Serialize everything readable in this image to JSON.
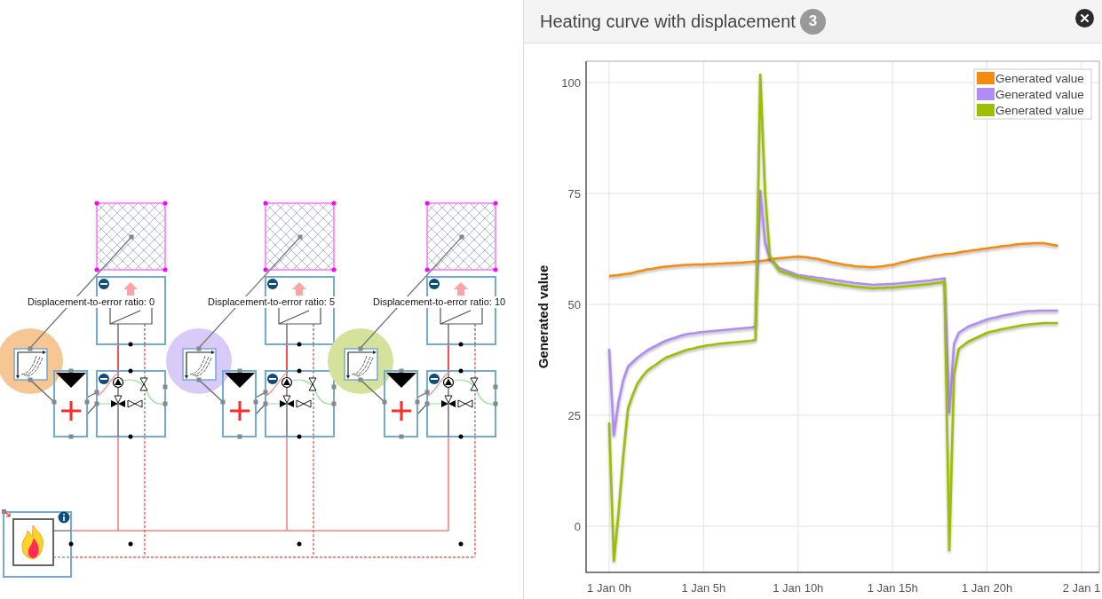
{
  "diagram": {
    "units": [
      {
        "label": "Displacement-to-error ratio: 0",
        "color": "#f6c793"
      },
      {
        "label": "Displacement-to-error ratio: 5",
        "color": "#d8cbf8"
      },
      {
        "label": "Displacement-to-error ratio: 10",
        "color": "#d5e29b"
      }
    ]
  },
  "panel": {
    "title": "Heating curve with displacement",
    "badge": "3",
    "chart_data": {
      "type": "line",
      "ylabel": "Generated value",
      "grid": true,
      "categories": [
        "1 Jan 0h",
        null,
        null,
        null,
        null,
        null,
        null,
        null,
        null,
        null,
        null,
        null,
        null,
        null,
        null,
        null,
        null,
        null,
        null,
        null,
        "1 Jan 5h",
        null,
        null,
        null,
        null,
        null,
        null,
        null,
        null,
        null,
        null,
        null,
        null,
        null,
        null,
        null,
        null,
        null,
        null,
        null,
        "1 Jan 10h",
        null,
        null,
        null,
        null,
        null,
        null,
        null,
        null,
        null,
        null,
        null,
        null,
        null,
        null,
        null,
        null,
        null,
        null,
        null,
        "1 Jan 15h",
        null,
        null,
        null,
        null,
        null,
        null,
        null,
        null,
        null,
        null,
        null,
        null,
        null,
        null,
        null,
        null,
        null,
        null,
        null,
        "1 Jan 20h",
        null,
        null,
        null,
        null,
        null,
        null,
        null,
        null,
        null,
        null,
        null,
        null,
        null,
        null,
        null,
        null,
        null,
        null,
        null,
        "2 Jan 1"
      ],
      "series": [
        {
          "name": "Generated value",
          "color": "#f7890c",
          "values": [
            56.4,
            56.5,
            56.6,
            56.8,
            56.9,
            57.1,
            57.4,
            57.6,
            57.9,
            58.0,
            58.2,
            58.4,
            58.5,
            58.6,
            58.7,
            58.8,
            58.9,
            58.9,
            59.0,
            59.0,
            59.0,
            59.1,
            59.1,
            59.2,
            59.2,
            59.3,
            59.3,
            59.4,
            59.4,
            59.5,
            59.6,
            59.7,
            59.8,
            59.9,
            60.1,
            60.3,
            60.4,
            60.5,
            60.6,
            60.7,
            60.8,
            60.7,
            60.6,
            60.4,
            60.3,
            60.0,
            59.8,
            59.5,
            59.3,
            59.1,
            58.9,
            58.8,
            58.6,
            58.5,
            58.5,
            58.4,
            58.4,
            58.5,
            58.6,
            58.8,
            58.9,
            59.2,
            59.5,
            59.7,
            60.0,
            60.2,
            60.4,
            60.6,
            60.8,
            61.0,
            61.1,
            61.3,
            61.4,
            61.5,
            61.7,
            61.9,
            62.0,
            62.2,
            62.3,
            62.5,
            62.6,
            62.8,
            62.9,
            63.1,
            63.2,
            63.3,
            63.5,
            63.6,
            63.7,
            63.7,
            63.8,
            63.8,
            63.8,
            63.6,
            63.4,
            63.2,
            null,
            null,
            null,
            null,
            null
          ]
        },
        {
          "name": "Generated value",
          "color": "#b18cf7",
          "values": [
            40,
            20.5,
            28,
            33,
            36,
            37,
            38,
            38.8,
            39.6,
            40.2,
            40.7,
            41.3,
            41.8,
            42.2,
            42.5,
            42.9,
            43.2,
            43.4,
            43.5,
            43.7,
            43.8,
            43.9,
            44.0,
            44.1,
            44.2,
            44.3,
            44.4,
            44.5,
            44.6,
            44.7,
            44.8,
            45,
            75.6,
            63.9,
            60.6,
            59.4,
            58.2,
            57.8,
            57.4,
            57.0,
            56.6,
            56.5,
            56.3,
            56.2,
            56,
            55.9,
            55.7,
            55.6,
            55.4,
            55.3,
            55.1,
            55.0,
            54.8,
            54.7,
            54.6,
            54.5,
            54.4,
            54.5,
            54.5,
            54.6,
            54.6,
            54.7,
            54.8,
            54.9,
            55,
            55.1,
            55.2,
            55.3,
            55.4,
            55.6,
            55.7,
            55.9,
            25.6,
            41.1,
            43.6,
            44.3,
            45,
            45.4,
            45.8,
            46.2,
            46.6,
            46.9,
            47.1,
            47.4,
            47.6,
            47.8,
            48.0,
            48.2,
            48.4,
            48.5,
            48.5,
            48.6,
            48.6,
            48.6,
            48.6,
            48.6,
            null,
            null,
            null,
            null,
            null
          ]
        },
        {
          "name": "Generated value",
          "color": "#9cbf00",
          "values": [
            23.4,
            -7.8,
            3,
            16,
            26.6,
            29.6,
            32.2,
            33.7,
            35,
            35.8,
            36.5,
            37.3,
            38,
            38.4,
            38.8,
            39.2,
            39.6,
            39.9,
            40.1,
            40.4,
            40.6,
            40.8,
            40.9,
            41.1,
            41.2,
            41.3,
            41.4,
            41.5,
            41.6,
            41.7,
            41.8,
            42,
            101.8,
            75.2,
            61,
            59.3,
            57.6,
            57.2,
            56.9,
            56.5,
            56.2,
            56.0,
            55.8,
            55.6,
            55.4,
            55.2,
            55.0,
            54.8,
            54.6,
            54.5,
            54.3,
            54.2,
            54,
            53.9,
            53.8,
            53.7,
            53.6,
            53.7,
            53.7,
            53.8,
            53.8,
            53.9,
            54.0,
            54.1,
            54.2,
            54.3,
            54.4,
            54.5,
            54.6,
            54.8,
            54.9,
            55.1,
            -5.4,
            34.2,
            40,
            40.8,
            41.6,
            42.1,
            42.6,
            43.1,
            43.6,
            43.9,
            44.1,
            44.4,
            44.6,
            44.8,
            45.0,
            45.2,
            45.4,
            45.5,
            45.6,
            45.7,
            45.8,
            45.8,
            45.8,
            45.8,
            null,
            null,
            null,
            null,
            null
          ]
        }
      ],
      "ylim": [
        -10.4,
        104.8
      ],
      "yticks": [
        0,
        25,
        50,
        75,
        100
      ]
    }
  }
}
